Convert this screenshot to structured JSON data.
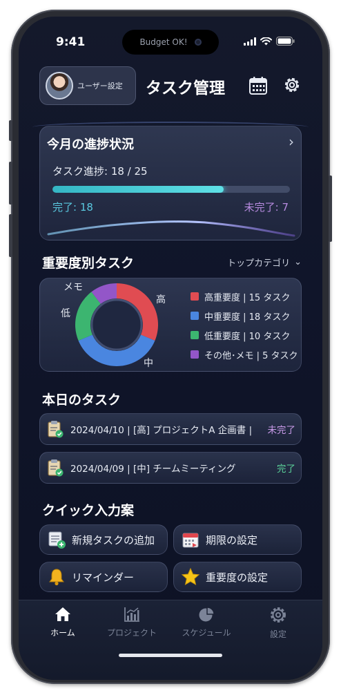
{
  "status_bar": {
    "time": "9:41",
    "island_text": "Budget OK!"
  },
  "header": {
    "user_button_label": "ユーザー設定",
    "title": "タスク管理"
  },
  "progress_card": {
    "title": "今月の進捗状況",
    "progress_label": "タスク進捗: 18 / 25",
    "completed": 18,
    "total": 25,
    "completed_label": "完了: 18",
    "incomplete_label": "未完了: 7"
  },
  "priority_section": {
    "title": "重要度別タスク",
    "filter_label": "トップカテゴリ",
    "chart_data": {
      "type": "pie",
      "categories": [
        "高",
        "中",
        "低",
        "メモ"
      ],
      "values": [
        15,
        18,
        10,
        5
      ],
      "colors": [
        "#e04c52",
        "#4a86e0",
        "#3cb570",
        "#9356c8"
      ]
    },
    "donut_labels": {
      "high": "高",
      "mid": "中",
      "low": "低",
      "memo": "メモ"
    },
    "legend": [
      {
        "label": "高重要度 | 15 タスク",
        "color": "#e04c52"
      },
      {
        "label": "中重要度 | 18 タスク",
        "color": "#4a86e0"
      },
      {
        "label": "低重要度 | 10 タスク",
        "color": "#3cb570"
      },
      {
        "label": "その他･メモ | 5 タスク",
        "color": "#9356c8"
      }
    ]
  },
  "today_section": {
    "title": "本日のタスク",
    "tasks": [
      {
        "text": "2024/04/10 | [高] プロジェクトA 企画書 |",
        "status": "未完了",
        "status_color": "#c99be8"
      },
      {
        "text": "2024/04/09 | [中] チームミーティング",
        "status": "完了",
        "status_color": "#5bd29a"
      }
    ]
  },
  "quick_section": {
    "title": "クイック入力案",
    "buttons": [
      {
        "label": "新規タスクの追加",
        "icon": "add-task-icon"
      },
      {
        "label": "期限の設定",
        "icon": "calendar-icon"
      },
      {
        "label": "リマインダー",
        "icon": "bell-icon"
      },
      {
        "label": "重要度の設定",
        "icon": "star-icon"
      }
    ]
  },
  "tabbar": {
    "tabs": [
      {
        "label": "ホーム",
        "icon": "home-icon",
        "active": true
      },
      {
        "label": "プロジェクト",
        "icon": "bar-chart-icon",
        "active": false
      },
      {
        "label": "スケジュール",
        "icon": "pie-chart-icon",
        "active": false
      },
      {
        "label": "設定",
        "icon": "gear-icon",
        "active": false
      }
    ]
  }
}
